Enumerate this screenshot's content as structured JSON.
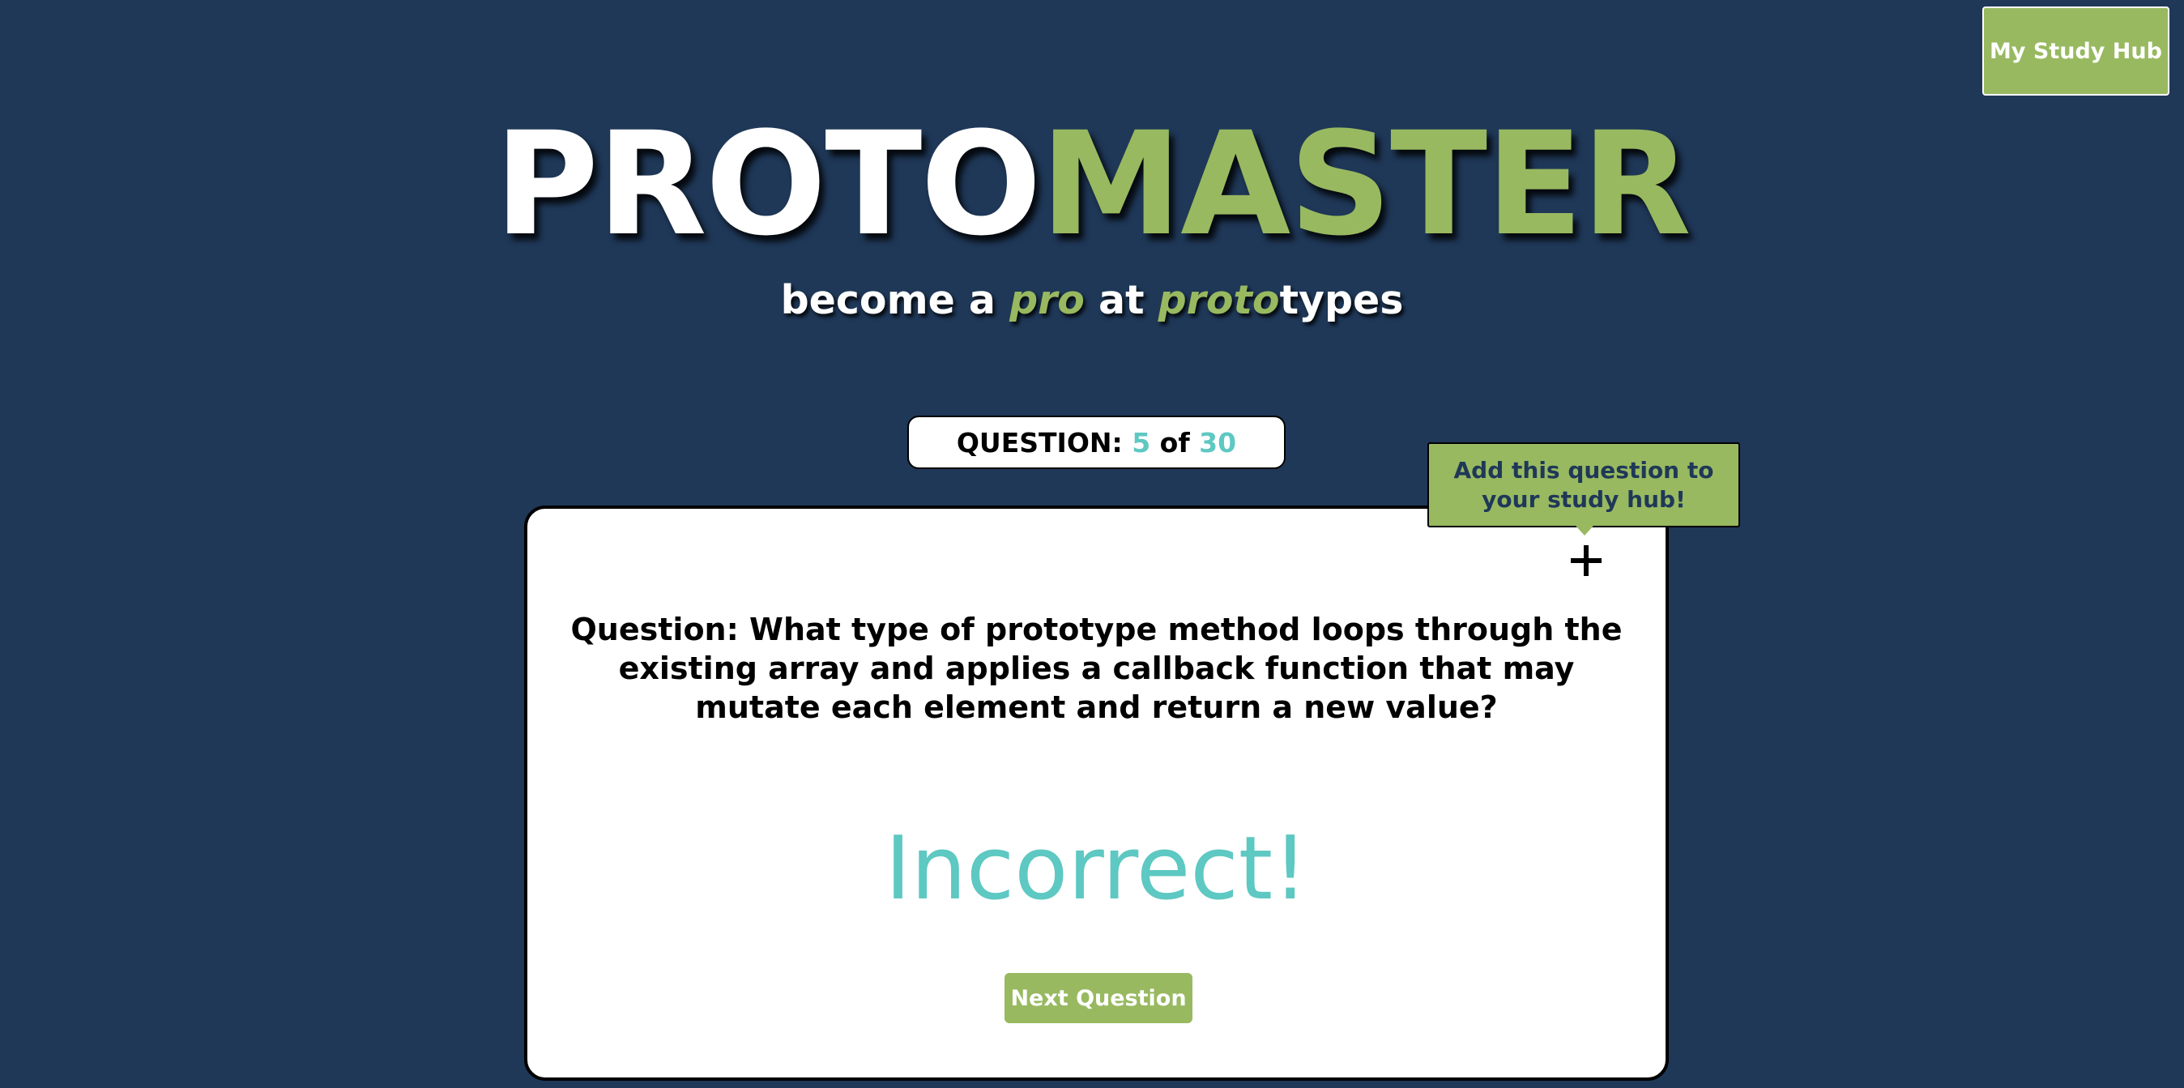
{
  "header": {
    "study_hub_button": "My Study Hub",
    "logo": {
      "part1": "PROTO",
      "part2": "MASTER"
    },
    "tagline": {
      "t1": "become a ",
      "t2": "pro",
      "t3": " at ",
      "t4": "proto",
      "t5": "types"
    }
  },
  "counter": {
    "label": "QUESTION: ",
    "current": "5",
    "separator": " of ",
    "total": "30"
  },
  "card": {
    "question": "Question: What type of prototype method loops through the existing array and applies a callback function that may mutate each element and return a new value?",
    "result": "Incorrect!",
    "next_button": "Next Question"
  },
  "tooltip": {
    "text": "Add this question to your study hub!"
  },
  "icons": {
    "add": "plus-icon"
  },
  "colors": {
    "background": "#1f3858",
    "accent_green": "#98b960",
    "accent_teal": "#5ec8c2"
  }
}
